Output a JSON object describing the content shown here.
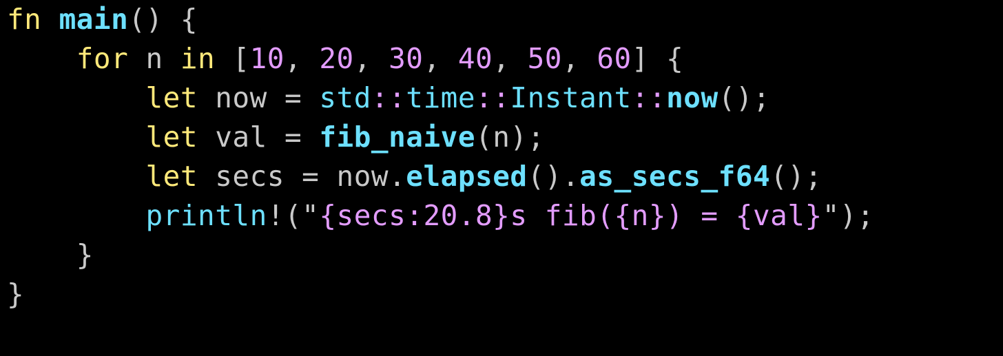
{
  "code": {
    "l1": {
      "fn": "fn",
      "main": "main",
      "parens": "()",
      "brace": "{"
    },
    "l2": {
      "for": "for",
      "n": "n",
      "in": "in",
      "lbrack": "[",
      "v1": "10",
      "v2": "20",
      "v3": "30",
      "v4": "40",
      "v5": "50",
      "v6": "60",
      "comma": ", ",
      "rbrack": "]",
      "brace": "{"
    },
    "l3": {
      "let": "let",
      "now": "now",
      "eq": "=",
      "std": "std",
      "sep": "::",
      "time": "time",
      "instant": "Instant",
      "nowfn": "now",
      "tail": "();"
    },
    "l4": {
      "let": "let",
      "val": "val",
      "eq": "=",
      "fib": "fib_naive",
      "open": "(",
      "n": "n",
      "close": ");"
    },
    "l5": {
      "let": "let",
      "secs": "secs",
      "eq": "=",
      "now": "now",
      "dot": ".",
      "elapsed": "elapsed",
      "p1": "()",
      "as_secs": "as_secs_f64",
      "tail": "();"
    },
    "l6": {
      "println": "println",
      "bang": "!",
      "open": "(",
      "q1": "\"",
      "s1": "{secs:20.8}s fib({n}) = {val}",
      "q2": "\"",
      "close": ");"
    },
    "l7": {
      "brace": "}"
    },
    "l8": {
      "brace": "}"
    }
  }
}
